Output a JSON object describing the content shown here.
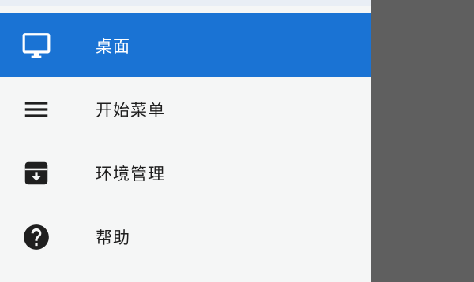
{
  "menu": {
    "items": [
      {
        "label": "桌面",
        "icon": "desktop-monitor-icon",
        "active": true
      },
      {
        "label": "开始菜单",
        "icon": "hamburger-menu-icon",
        "active": false
      },
      {
        "label": "环境管理",
        "icon": "archive-box-icon",
        "active": false
      },
      {
        "label": "帮助",
        "icon": "help-circle-icon",
        "active": false
      }
    ]
  },
  "colors": {
    "active_bg": "#1a73d4",
    "drawer_bg": "#f5f6f6",
    "scrim": "#5f5f5f",
    "text": "#1f1f1f"
  }
}
